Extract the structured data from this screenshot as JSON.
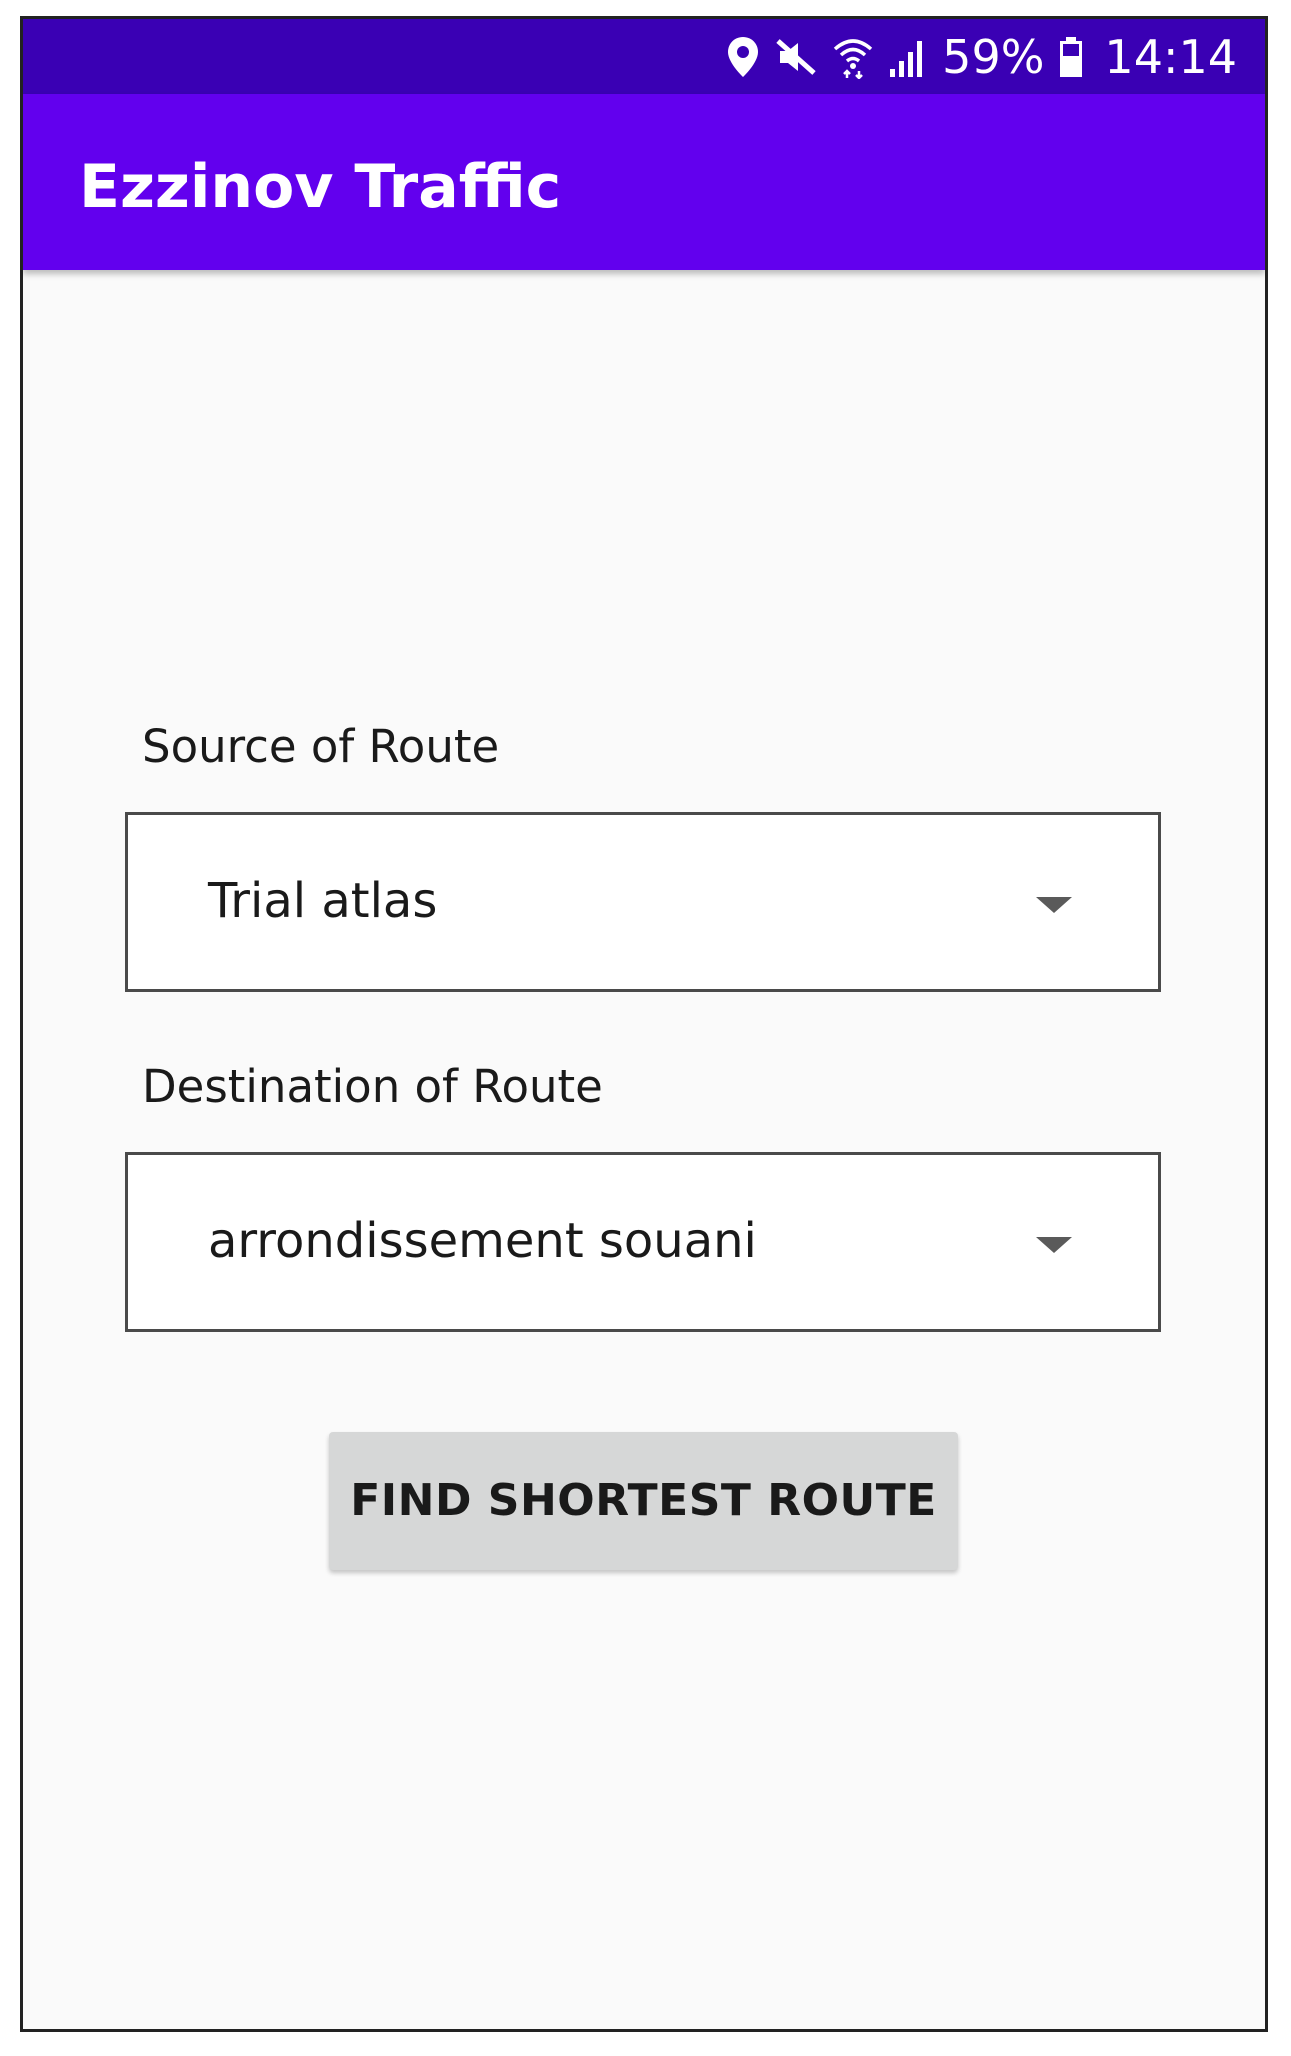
{
  "status_bar": {
    "battery_percent": "59%",
    "time": "14:14",
    "icons": [
      "location-icon",
      "mute-icon",
      "wifi-icon",
      "signal-icon",
      "battery-icon"
    ],
    "background_color": "#3a00b4"
  },
  "app_bar": {
    "title": "Ezzinov Traffic",
    "background_color": "#6200ee"
  },
  "form": {
    "source": {
      "label": "Source of Route",
      "selected_value": "Trial atlas"
    },
    "destination": {
      "label": "Destination of Route",
      "selected_value": "arrondissement souani"
    },
    "submit": {
      "label": "FIND SHORTEST ROUTE",
      "background_color": "#d6d7d7"
    }
  }
}
